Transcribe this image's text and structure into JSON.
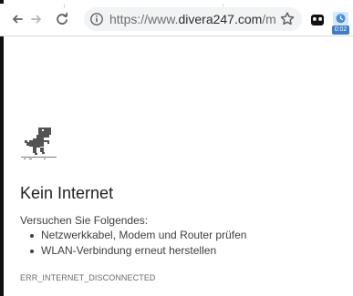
{
  "browser": {
    "url_prefix": "https://www.",
    "url_domain": "divera247.com",
    "url_suffix": "/mon...",
    "extension_badge": "0:02",
    "icons": {
      "back": "arrow-left-icon",
      "forward": "arrow-right-icon",
      "reload": "reload-icon",
      "info": "info-icon",
      "bookmark": "star-icon",
      "extension_1": "extension-icon",
      "extension_2": "extension-timer-icon"
    }
  },
  "error_page": {
    "title": "Kein Internet",
    "subtitle": "Versuchen Sie Folgendes:",
    "suggestions": [
      "Netzwerkkabel, Modem und Router prüfen",
      "WLAN-Verbindung erneut herstellen"
    ],
    "error_code": "ERR_INTERNET_DISCONNECTED",
    "illustration": "dinosaur-icon"
  },
  "colors": {
    "text_primary": "#202124",
    "text_secondary": "#3c4043",
    "omnibox": "#f1f3f4",
    "badge": "#3f7cc7"
  }
}
